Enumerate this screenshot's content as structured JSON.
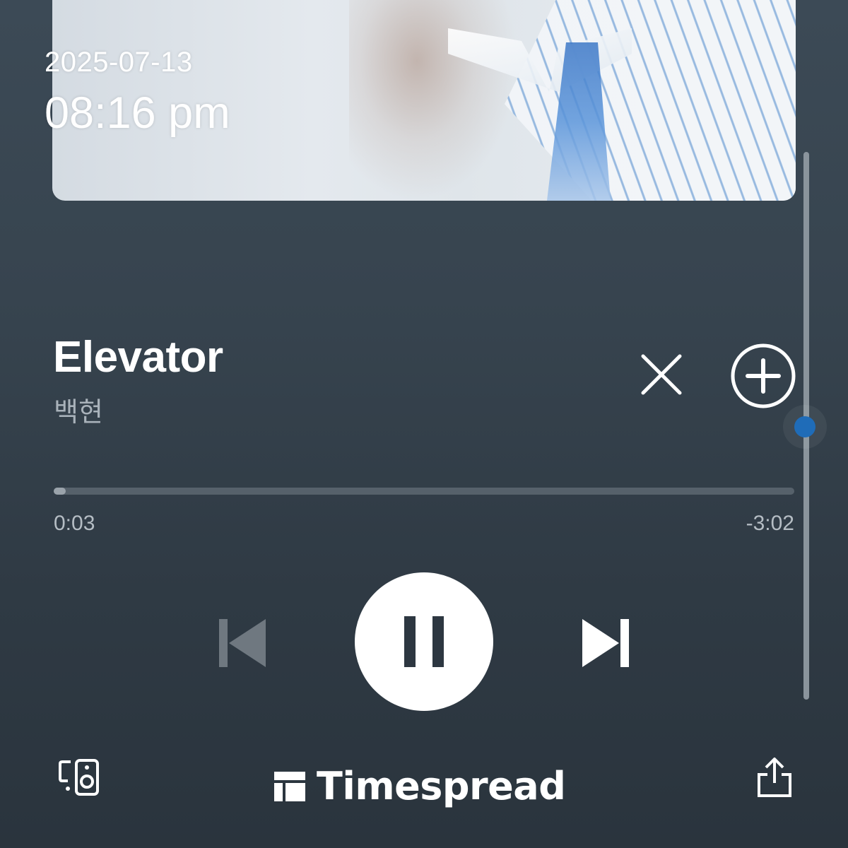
{
  "overlay": {
    "date": "2025-07-13",
    "time": "08:16 pm"
  },
  "track": {
    "title": "Elevator",
    "artist": "백현"
  },
  "progress": {
    "elapsed": "0:03",
    "remaining": "-3:02",
    "fraction": 0.016
  },
  "volume": {
    "level": 0.5
  },
  "controls": {
    "close_icon": "close-icon",
    "add_icon": "add-circle-icon",
    "prev_icon": "skip-previous-icon",
    "play_state_icon": "pause-icon",
    "next_icon": "skip-next-icon",
    "device_icon": "device-speaker-icon",
    "share_icon": "share-icon"
  },
  "watermark": {
    "brand": "Timespread",
    "logo_icon": "timespread-logo-icon"
  },
  "colors": {
    "accent": "#1f6cb8",
    "background_top": "#3c4a56",
    "background_bottom": "#2a343d",
    "secondary_text": "#a9b2ba"
  }
}
